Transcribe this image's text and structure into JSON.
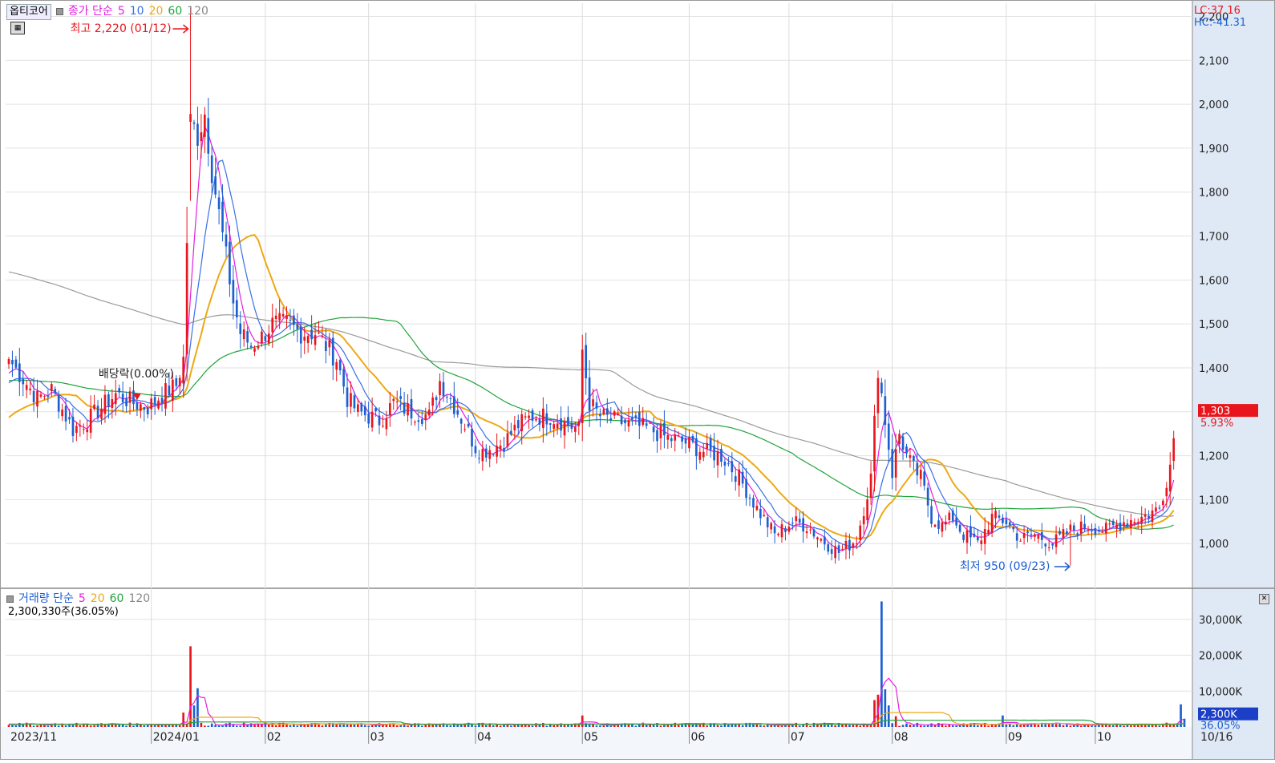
{
  "header": {
    "title": "옵티코어",
    "price_legend": {
      "label": "종가 단순",
      "ma5": "5",
      "ma10": "10",
      "ma20": "20",
      "ma60": "60",
      "ma120": "120"
    },
    "lc": "LC:37.16",
    "hc": "HC:-41.31",
    "high_annotation": "최고 2,220 (01/12)",
    "low_annotation": "최저 950 (09/23)",
    "dividend_annotation": "배당락(0.00%)",
    "current_price": "1,303",
    "current_change": "5.93%"
  },
  "volume_panel": {
    "label": "거래량 단순",
    "ma5": "5",
    "ma20": "20",
    "ma60": "60",
    "ma120": "120",
    "current": "2,300,330주(36.05%)",
    "current_badge": "2,300K",
    "current_pct": "36.05%"
  },
  "colors": {
    "up": "#e8161c",
    "down": "#1c5fd1",
    "ma5": "#e51ee0",
    "ma10": "#3a6fe6",
    "ma20": "#eda915",
    "ma60": "#1fa53b",
    "ma120": "#9a9a9a",
    "axis_bg": "#dfe9f6"
  },
  "chart_data": {
    "type": "candlestick",
    "title": "옵티코어",
    "price_axis": {
      "range": [
        900,
        2230
      ],
      "ticks": [
        1000,
        1100,
        1200,
        1300,
        1400,
        1500,
        1600,
        1700,
        1800,
        1900,
        2000,
        2100,
        2200
      ],
      "tick_labels": [
        "1,000",
        "1,100",
        "1,200",
        "1,300",
        "1,400",
        "1,500",
        "1,600",
        "1,700",
        "1,800",
        "1,900",
        "2,000",
        "2,100",
        "2,200"
      ]
    },
    "volume_axis": {
      "range": [
        0,
        36000
      ],
      "ticks": [
        10000,
        20000,
        30000
      ],
      "tick_labels": [
        "10,000K",
        "20,000K",
        "30,000K"
      ]
    },
    "x_axis": {
      "labels": [
        "2023/11",
        "2024/01",
        "02",
        "03",
        "04",
        "05",
        "06",
        "07",
        "08",
        "09",
        "10",
        "10/16"
      ],
      "label_index": [
        0,
        40,
        72,
        101,
        131,
        161,
        191,
        219,
        248,
        280,
        305,
        330
      ]
    },
    "high": {
      "value": 2220,
      "date": "01/12"
    },
    "low": {
      "value": 950,
      "date": "09/23"
    },
    "last": {
      "value": 1303,
      "change_pct": 5.93
    },
    "anchors": {
      "idx": [
        0,
        8,
        12,
        18,
        22,
        26,
        30,
        35,
        39,
        43,
        47,
        49,
        51,
        53,
        55,
        57,
        59,
        61,
        63,
        65,
        68,
        71,
        74,
        78,
        82,
        86,
        89,
        92,
        95,
        98,
        101,
        104,
        108,
        113,
        118,
        121,
        124,
        128,
        131,
        133,
        136,
        139,
        143,
        147,
        152,
        157,
        160,
        161,
        163,
        166,
        170,
        175,
        180,
        185,
        190,
        195,
        200,
        205,
        210,
        215,
        220,
        224,
        228,
        233,
        238,
        242,
        244,
        246,
        248,
        250,
        252,
        254,
        256,
        259,
        262,
        265,
        268,
        272,
        276,
        280,
        284,
        288,
        293,
        298,
        303,
        308,
        313,
        318,
        323,
        326,
        328,
        330
      ],
      "close": [
        1420,
        1330,
        1350,
        1260,
        1280,
        1310,
        1340,
        1320,
        1310,
        1340,
        1360,
        1420,
        1960,
        1930,
        1980,
        1850,
        1750,
        1650,
        1550,
        1480,
        1450,
        1470,
        1500,
        1500,
        1480,
        1480,
        1450,
        1420,
        1330,
        1300,
        1290,
        1280,
        1320,
        1300,
        1290,
        1370,
        1330,
        1270,
        1220,
        1210,
        1220,
        1230,
        1270,
        1290,
        1290,
        1270,
        1260,
        1440,
        1320,
        1290,
        1280,
        1270,
        1260,
        1240,
        1230,
        1210,
        1200,
        1150,
        1080,
        1020,
        1050,
        1040,
        1010,
        980,
        1010,
        1150,
        1400,
        1280,
        1160,
        1250,
        1200,
        1170,
        1150,
        1060,
        1040,
        1060,
        1020,
        1000,
        1060,
        1050,
        1010,
        1020,
        1000,
        1030,
        1040,
        1030,
        1050,
        1060,
        1080,
        1180,
        1303
      ]
    },
    "volume_spikes": [
      {
        "idx": 49,
        "value": 4000
      },
      {
        "idx": 51,
        "value": 22500
      },
      {
        "idx": 53,
        "value": 10800
      },
      {
        "idx": 52,
        "value": 6000
      },
      {
        "idx": 161,
        "value": 3200
      },
      {
        "idx": 243,
        "value": 7500
      },
      {
        "idx": 244,
        "value": 9000
      },
      {
        "idx": 245,
        "value": 35000
      },
      {
        "idx": 246,
        "value": 10500
      },
      {
        "idx": 247,
        "value": 6000
      },
      {
        "idx": 249,
        "value": 3000
      },
      {
        "idx": 279,
        "value": 3200
      },
      {
        "idx": 329,
        "value": 6300
      },
      {
        "idx": 330,
        "value": 2300
      }
    ]
  }
}
